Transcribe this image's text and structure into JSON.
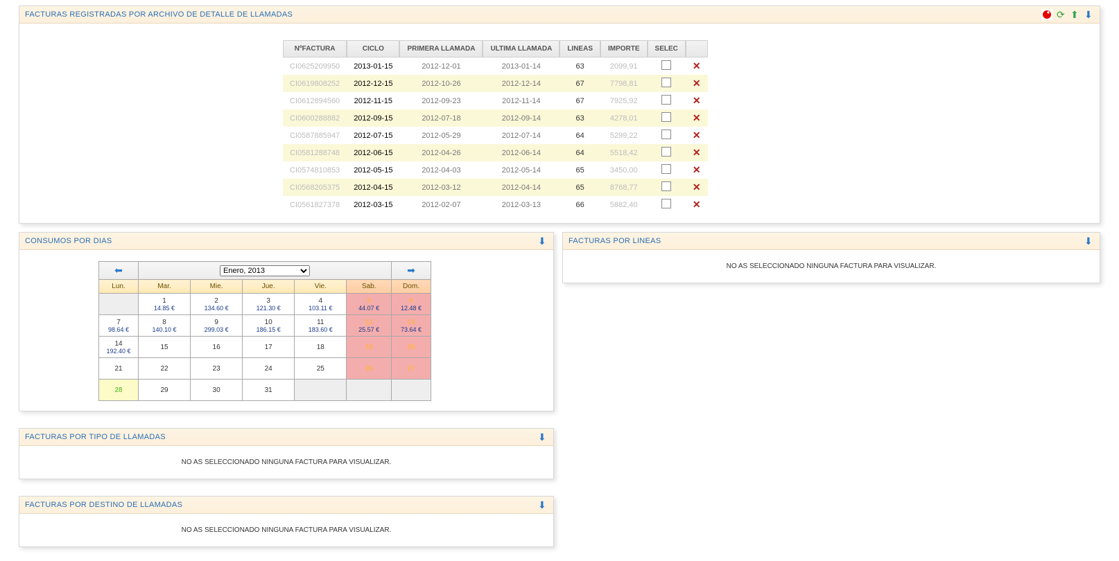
{
  "panels": {
    "invoices": {
      "title": "FACTURAS REGISTRADAS POR ARCHIVO DE DETALLE DE LLAMADAS"
    },
    "consumos": {
      "title": "CONSUMOS POR DIAS"
    },
    "porLineas": {
      "title": "FACTURAS POR LINEAS",
      "empty": "NO AS SELECCIONADO NINGUNA FACTURA PARA VISUALIZAR."
    },
    "porTipo": {
      "title": "FACTURAS POR TIPO DE LLAMADAS",
      "empty": "NO AS SELECCIONADO NINGUNA FACTURA PARA VISUALIZAR."
    },
    "porDestino": {
      "title": "FACTURAS POR DESTINO DE LLAMADAS",
      "empty": "NO AS SELECCIONADO NINGUNA FACTURA PARA VISUALIZAR."
    }
  },
  "invoices": {
    "headers": {
      "nf": "NºFACTURA",
      "ciclo": "CICLO",
      "primera": "PRIMERA LLAMADA",
      "ultima": "ULTIMA LLAMADA",
      "lineas": "LINEAS",
      "importe": "IMPORTE",
      "selec": "SELEC"
    },
    "rows": [
      {
        "nf": "CI0625209950",
        "ciclo": "2013-01-15",
        "primera": "2012-12-01",
        "ultima": "2013-01-14",
        "lineas": "63",
        "importe": "2099,91"
      },
      {
        "nf": "CI0619808252",
        "ciclo": "2012-12-15",
        "primera": "2012-10-26",
        "ultima": "2012-12-14",
        "lineas": "67",
        "importe": "7798,81"
      },
      {
        "nf": "CI0612894560",
        "ciclo": "2012-11-15",
        "primera": "2012-09-23",
        "ultima": "2012-11-14",
        "lineas": "67",
        "importe": "7925,92"
      },
      {
        "nf": "CI0600288882",
        "ciclo": "2012-09-15",
        "primera": "2012-07-18",
        "ultima": "2012-09-14",
        "lineas": "63",
        "importe": "4278,01"
      },
      {
        "nf": "CI0587885947",
        "ciclo": "2012-07-15",
        "primera": "2012-05-29",
        "ultima": "2012-07-14",
        "lineas": "64",
        "importe": "5299,22"
      },
      {
        "nf": "CI0581288748",
        "ciclo": "2012-06-15",
        "primera": "2012-04-26",
        "ultima": "2012-06-14",
        "lineas": "64",
        "importe": "5518,42"
      },
      {
        "nf": "CI0574810853",
        "ciclo": "2012-05-15",
        "primera": "2012-04-03",
        "ultima": "2012-05-14",
        "lineas": "65",
        "importe": "3450,00"
      },
      {
        "nf": "CI0568205375",
        "ciclo": "2012-04-15",
        "primera": "2012-03-12",
        "ultima": "2012-04-14",
        "lineas": "65",
        "importe": "8768,77"
      },
      {
        "nf": "CI0561827378",
        "ciclo": "2012-03-15",
        "primera": "2012-02-07",
        "ultima": "2012-03-13",
        "lineas": "66",
        "importe": "5882,40"
      }
    ]
  },
  "calendar": {
    "month_label": "Enero, 2013",
    "dayheads": {
      "lun": "Lun.",
      "mar": "Mar.",
      "mie": "Mie.",
      "jue": "Jue.",
      "vie": "Vie.",
      "sab": "Sab.",
      "dom": "Dom."
    },
    "cells": [
      [
        {
          "blank": true
        },
        {
          "n": "1",
          "a": "14.85 €"
        },
        {
          "n": "2",
          "a": "134.60 €"
        },
        {
          "n": "3",
          "a": "121.30 €"
        },
        {
          "n": "4",
          "a": "103.11 €"
        },
        {
          "n": "5",
          "a": "44.07 €",
          "wk": true
        },
        {
          "n": "6",
          "a": "12.48 €",
          "wk": true
        }
      ],
      [
        {
          "n": "7",
          "a": "98.64 €"
        },
        {
          "n": "8",
          "a": "140.10 €"
        },
        {
          "n": "9",
          "a": "299.03 €"
        },
        {
          "n": "10",
          "a": "186.15 €"
        },
        {
          "n": "11",
          "a": "183.60 €"
        },
        {
          "n": "12",
          "a": "25.57 €",
          "wk": true
        },
        {
          "n": "13",
          "a": "73.64 €",
          "wk": true
        }
      ],
      [
        {
          "n": "14",
          "a": "192.40 €"
        },
        {
          "n": "15"
        },
        {
          "n": "16"
        },
        {
          "n": "17"
        },
        {
          "n": "18"
        },
        {
          "n": "19",
          "wk": true
        },
        {
          "n": "20",
          "wk": true
        }
      ],
      [
        {
          "n": "21"
        },
        {
          "n": "22"
        },
        {
          "n": "23"
        },
        {
          "n": "24"
        },
        {
          "n": "25"
        },
        {
          "n": "26",
          "wk": true
        },
        {
          "n": "27",
          "wk": true
        }
      ],
      [
        {
          "n": "28",
          "today": true
        },
        {
          "n": "29"
        },
        {
          "n": "30"
        },
        {
          "n": "31"
        },
        {
          "blank": true
        },
        {
          "blank": true
        },
        {
          "blank": true
        }
      ]
    ]
  }
}
